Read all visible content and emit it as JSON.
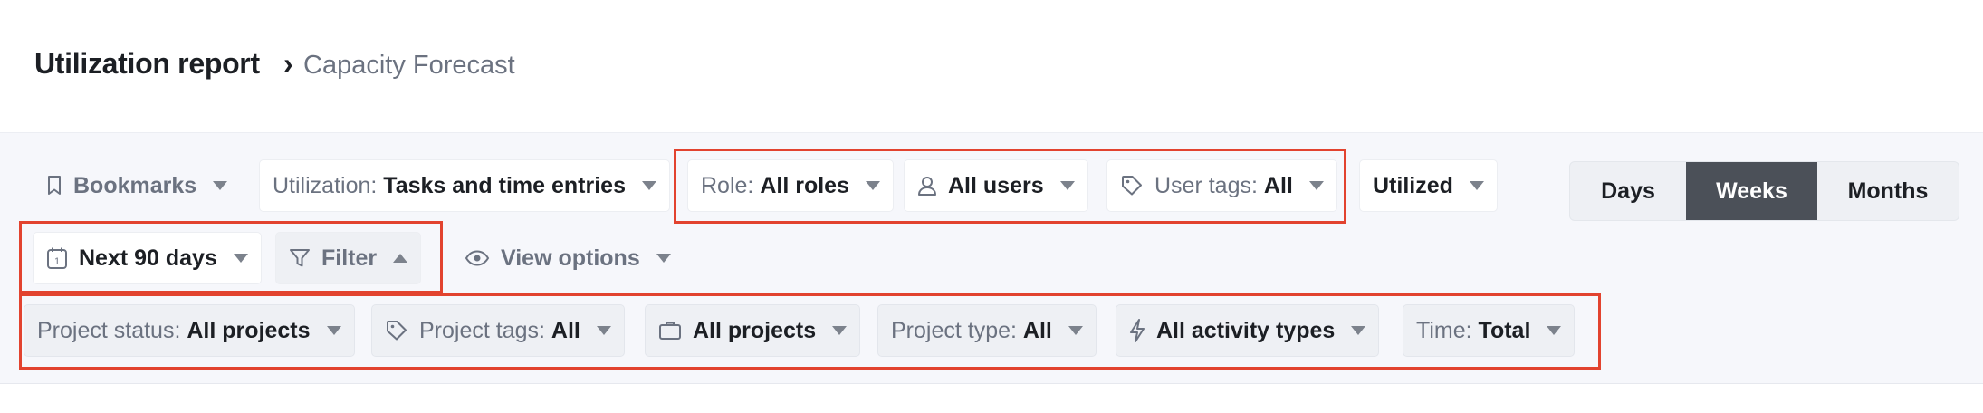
{
  "header": {
    "title": "Utilization report",
    "separator": "›",
    "breadcrumb": "Capacity Forecast"
  },
  "row1": {
    "bookmarks": "Bookmarks",
    "utilization_label": "Utilization:",
    "utilization_value": "Tasks and time entries",
    "role_label": "Role:",
    "role_value": "All roles",
    "users_value": "All users",
    "user_tags_label": "User tags:",
    "user_tags_value": "All",
    "utilized": "Utilized"
  },
  "period": {
    "days": "Days",
    "weeks": "Weeks",
    "months": "Months",
    "active": "Weeks"
  },
  "row2": {
    "range": "Next 90 days",
    "filter": "Filter",
    "view_options": "View options"
  },
  "row3": {
    "project_status_label": "Project status:",
    "project_status_value": "All projects",
    "project_tags_label": "Project tags:",
    "project_tags_value": "All",
    "projects_value": "All projects",
    "project_type_label": "Project type:",
    "project_type_value": "All",
    "activity_value": "All activity types",
    "time_label": "Time:",
    "time_value": "Total"
  },
  "colors": {
    "highlight": "#e2432f",
    "active_segment": "#4b5058",
    "toolbar_bg": "#f6f7fb"
  }
}
